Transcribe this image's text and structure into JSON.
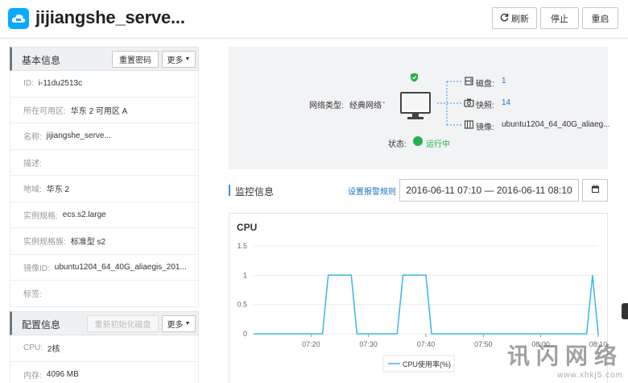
{
  "header": {
    "title": "jijiangshe_serve...",
    "refresh_label": "刷新",
    "stop_label": "停止",
    "reboot_label": "重启"
  },
  "basic_info": {
    "title": "基本信息",
    "reset_password_label": "重置密码",
    "more_label": "更多",
    "rows": [
      {
        "key": "ID:",
        "value": "i-11du2513c"
      },
      {
        "key": "所在可用区:",
        "value": "华东 2 可用区 A"
      },
      {
        "key": "名称:",
        "value": "jijiangshe_serve..."
      },
      {
        "key": "描述:",
        "value": ""
      },
      {
        "key": "地域:",
        "value": "华东 2"
      },
      {
        "key": "实例规格:",
        "value": "ecs.s2.large"
      },
      {
        "key": "实例规格族:",
        "value": "标准型 s2"
      },
      {
        "key": "镜像ID:",
        "value": "ubuntu1204_64_40G_aliaegis_201..."
      },
      {
        "key": "标签:",
        "value": ""
      }
    ]
  },
  "config_info": {
    "title": "配置信息",
    "reinit_disk_label": "重新初始化磁盘",
    "more_label": "更多",
    "rows": [
      {
        "key": "CPU:",
        "value": "2核"
      },
      {
        "key": "内存:",
        "value": "4096 MB"
      }
    ]
  },
  "overview": {
    "network_type_label": "网络类型:",
    "network_type_value": "经典网络",
    "disk_label": "磁盘:",
    "disk_value": "1",
    "snapshot_label": "快照:",
    "snapshot_value": "14",
    "image_label": "镜像:",
    "image_value": "ubuntu1204_64_40G_aliaeg...",
    "status_label": "状态:",
    "status_value": "运行中",
    "status_color": "#22b14c"
  },
  "monitor": {
    "title": "监控信息",
    "alarm_rule_link": "设置报警规则",
    "date_range": "2016-06-11 07:10 — 2016-06-11 08:10"
  },
  "chart_data": {
    "type": "line",
    "title": "CPU",
    "ylim": [
      0,
      1.5
    ],
    "y_ticks": [
      "1.5",
      "1",
      "0.5",
      "0"
    ],
    "x_ticks": [
      "07:20",
      "07:30",
      "07:40",
      "07:50",
      "08:00",
      "08:10"
    ],
    "series": [
      {
        "name": "CPU使用率(%)",
        "color": "#36b8e6",
        "points": [
          [
            "07:10",
            0
          ],
          [
            "07:20",
            0
          ],
          [
            "07:22",
            0
          ],
          [
            "07:23",
            1
          ],
          [
            "07:27",
            1
          ],
          [
            "07:28",
            0
          ],
          [
            "07:35",
            0
          ],
          [
            "07:36",
            1
          ],
          [
            "07:40",
            1
          ],
          [
            "07:41",
            0
          ],
          [
            "08:08",
            0
          ],
          [
            "08:09",
            1
          ],
          [
            "08:10",
            0
          ]
        ]
      }
    ],
    "grid": true,
    "legend": "bottom-center"
  },
  "watermark": {
    "title": "讯闪网络",
    "url": "www.xhkj5.com"
  }
}
